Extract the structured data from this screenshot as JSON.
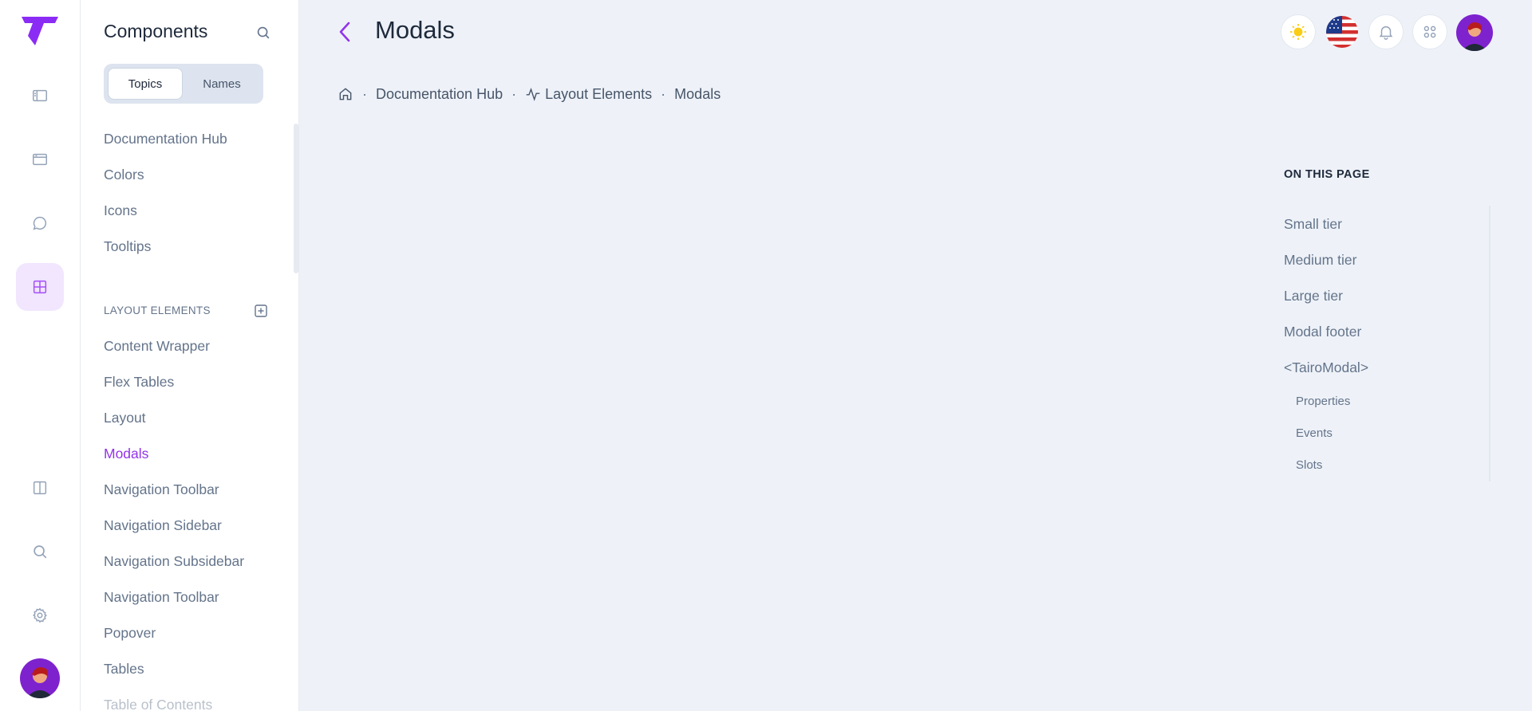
{
  "subsidebar": {
    "title": "Components",
    "tabs": [
      "Topics",
      "Names"
    ],
    "items": [
      "Documentation Hub",
      "Colors",
      "Icons",
      "Tooltips"
    ],
    "section_label": "LAYOUT ELEMENTS",
    "layout_items": [
      "Content Wrapper",
      "Flex Tables",
      "Layout",
      "Modals",
      "Navigation Toolbar",
      "Navigation Sidebar",
      "Navigation Subsidebar",
      "Navigation Toolbar",
      "Popover",
      "Tables",
      "Table of Contents"
    ],
    "active_item": "Modals"
  },
  "header": {
    "title": "Modals"
  },
  "breadcrumb": [
    "Documentation Hub",
    "Layout Elements",
    "Modals"
  ],
  "toc": {
    "heading": "ON THIS PAGE",
    "items": [
      "Small tier",
      "Medium tier",
      "Large tier",
      "Modal footer",
      "<TairoModal>"
    ],
    "sub_items": [
      "Properties",
      "Events",
      "Slots"
    ]
  },
  "colors": {
    "accent": "#9333ea",
    "background": "#eef2f8",
    "text_muted": "#64748b",
    "text_dark": "#1e293b"
  },
  "icons": {
    "rail": [
      "sidebar-icon",
      "window-icon",
      "chat-icon",
      "grid-icon",
      "columns-icon",
      "search-icon",
      "gear-icon"
    ],
    "header": [
      "sun-icon",
      "us-flag-icon",
      "bell-icon",
      "apps-icon"
    ]
  }
}
